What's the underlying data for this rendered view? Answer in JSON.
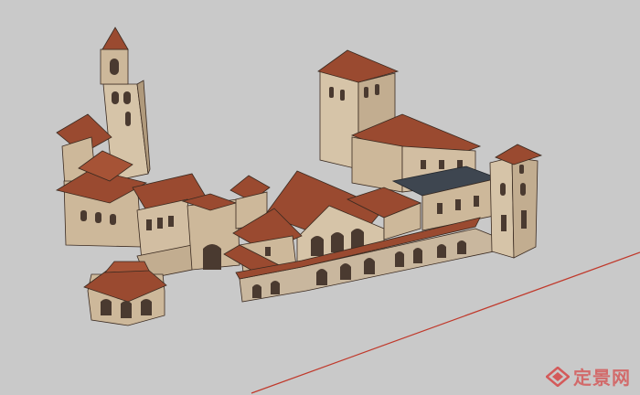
{
  "scene": {
    "background_color": "#c9c9c9",
    "wall_color": "#c9b79e",
    "roof_color": "#9a4a30",
    "dark_roof_color": "#3e4650",
    "axis_line_color": "#c0392b"
  },
  "watermark": {
    "text": "定景网",
    "icon": "diamond-logo-icon",
    "color": "#d45a5a"
  }
}
